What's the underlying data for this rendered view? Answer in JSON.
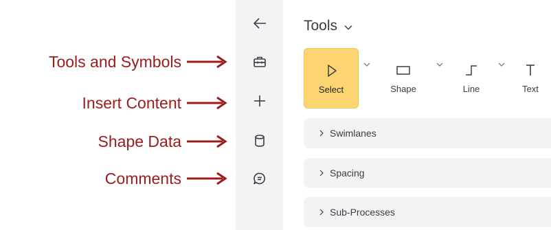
{
  "annotations": [
    {
      "label": "Tools and Symbols"
    },
    {
      "label": "Insert Content"
    },
    {
      "label": "Shape Data"
    },
    {
      "label": "Comments"
    }
  ],
  "annotation_color": "#9b1b1b",
  "rail": {
    "items": [
      {
        "icon": "arrow-left-icon"
      },
      {
        "icon": "toolbox-icon"
      },
      {
        "icon": "plus-icon"
      },
      {
        "icon": "database-icon"
      },
      {
        "icon": "comment-icon"
      }
    ]
  },
  "panel": {
    "title": "Tools",
    "tools": [
      {
        "label": "Select",
        "icon": "pointer-icon",
        "active": true
      },
      {
        "label": "Shape",
        "icon": "rectangle-icon"
      },
      {
        "label": "Line",
        "icon": "line-elbow-icon"
      },
      {
        "label": "Text",
        "icon": "text-icon"
      }
    ],
    "sections": [
      {
        "label": "Swimlanes"
      },
      {
        "label": "Spacing"
      },
      {
        "label": "Sub-Processes"
      }
    ]
  },
  "colors": {
    "active_tool": "#fcd572",
    "rail_bg": "#f2f3f4",
    "section_bg": "#f2f3f4"
  }
}
